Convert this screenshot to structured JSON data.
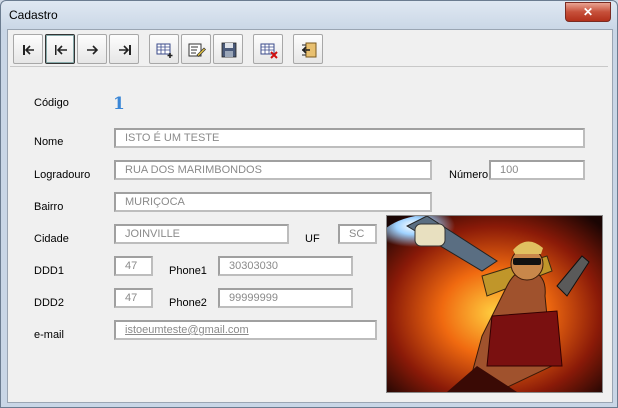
{
  "window": {
    "title": "Cadastro",
    "close_label": "✕"
  },
  "toolbar": {
    "buttons": [
      {
        "name": "first-record",
        "icon": "first-record-icon"
      },
      {
        "name": "previous-record",
        "icon": "previous-record-icon"
      },
      {
        "name": "next-record",
        "icon": "next-record-icon"
      },
      {
        "name": "last-record",
        "icon": "last-record-icon"
      },
      {
        "name": "new-record",
        "icon": "new-record-icon"
      },
      {
        "name": "edit-record",
        "icon": "edit-record-icon"
      },
      {
        "name": "save-record",
        "icon": "save-icon"
      },
      {
        "name": "delete-record",
        "icon": "delete-record-icon"
      },
      {
        "name": "exit",
        "icon": "exit-icon"
      }
    ]
  },
  "form": {
    "codigo_label": "Código",
    "codigo_value": "1",
    "nome_label": "Nome",
    "nome_value": "ISTO É UM TESTE",
    "logradouro_label": "Logradouro",
    "logradouro_value": "RUA DOS MARIMBONDOS",
    "numero_label": "Número",
    "numero_value": "100",
    "bairro_label": "Bairro",
    "bairro_value": "MURIÇOCA",
    "cidade_label": "Cidade",
    "cidade_value": "JOINVILLE",
    "uf_label": "UF",
    "uf_value": "SC",
    "ddd1_label": "DDD1",
    "ddd1_value": "47",
    "phone1_label": "Phone1",
    "phone1_value": "30303030",
    "ddd2_label": "DDD2",
    "ddd2_value": "47",
    "phone2_label": "Phone2",
    "phone2_value": "99999999",
    "email_label": "e-mail",
    "email_value": "istoeumteste@gmail.com"
  },
  "colors": {
    "accent": "#3a86d6",
    "close": "#c6503a"
  }
}
